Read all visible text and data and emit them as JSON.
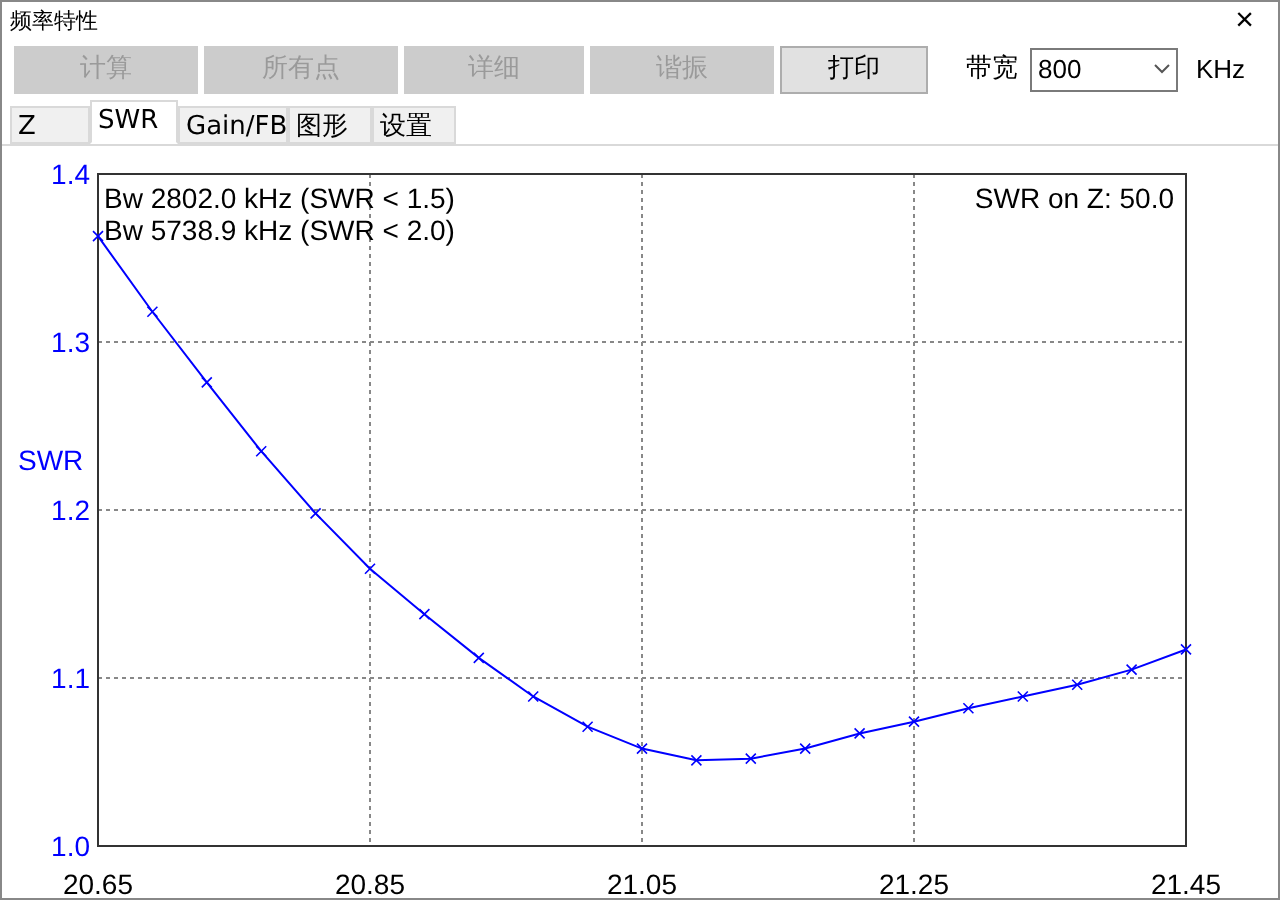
{
  "window": {
    "title": "频率特性",
    "close": "×"
  },
  "toolbar": {
    "buttons": [
      {
        "label": "计算",
        "disabled": true
      },
      {
        "label": "所有点",
        "disabled": true
      },
      {
        "label": "详细",
        "disabled": true
      },
      {
        "label": "谐振",
        "disabled": true
      },
      {
        "label": "打印",
        "disabled": false
      }
    ],
    "bandwidth_label": "带宽",
    "bandwidth_value": "800",
    "bandwidth_unit": "KHz"
  },
  "tabs": [
    {
      "label": "Z",
      "selected": false
    },
    {
      "label": "SWR",
      "selected": true
    },
    {
      "label": "Gain/FB",
      "selected": false
    },
    {
      "label": "图形",
      "selected": false
    },
    {
      "label": "设置",
      "selected": false
    }
  ],
  "plot": {
    "notes_left": [
      "Bw 2802.0 kHz (SWR < 1.5)",
      "Bw 5738.9 kHz (SWR < 2.0)"
    ],
    "note_right": "SWR on Z: 50.0",
    "chart_data": {
      "type": "line",
      "ylabel": "SWR",
      "x": [
        20.65,
        20.69,
        20.73,
        20.77,
        20.81,
        20.85,
        20.89,
        20.93,
        20.97,
        21.01,
        21.05,
        21.09,
        21.13,
        21.17,
        21.21,
        21.25,
        21.29,
        21.33,
        21.37,
        21.41,
        21.45
      ],
      "grid": true,
      "series": [
        {
          "color": "#0000ff",
          "marker": "x",
          "values": [
            1.363,
            1.318,
            1.276,
            1.235,
            1.198,
            1.165,
            1.138,
            1.112,
            1.089,
            1.071,
            1.058,
            1.051,
            1.052,
            1.058,
            1.067,
            1.074,
            1.082,
            1.089,
            1.096,
            1.105,
            1.117
          ]
        }
      ],
      "xlim": [
        20.65,
        21.45
      ],
      "ylim": [
        1.0,
        1.4
      ],
      "xticks": [
        {
          "value": 20.65,
          "label": "20.65"
        },
        {
          "value": 20.85,
          "label": "20.85"
        },
        {
          "value": 21.05,
          "label": "21.05"
        },
        {
          "value": 21.25,
          "label": "21.25"
        },
        {
          "value": 21.45,
          "label": "21.45"
        }
      ],
      "yticks": [
        {
          "value": 1.0,
          "label": "1.0"
        },
        {
          "value": 1.1,
          "label": "1.1"
        },
        {
          "value": 1.2,
          "label": "1.2"
        },
        {
          "value": 1.3,
          "label": "1.3"
        },
        {
          "value": 1.4,
          "label": "1.4"
        }
      ]
    }
  }
}
